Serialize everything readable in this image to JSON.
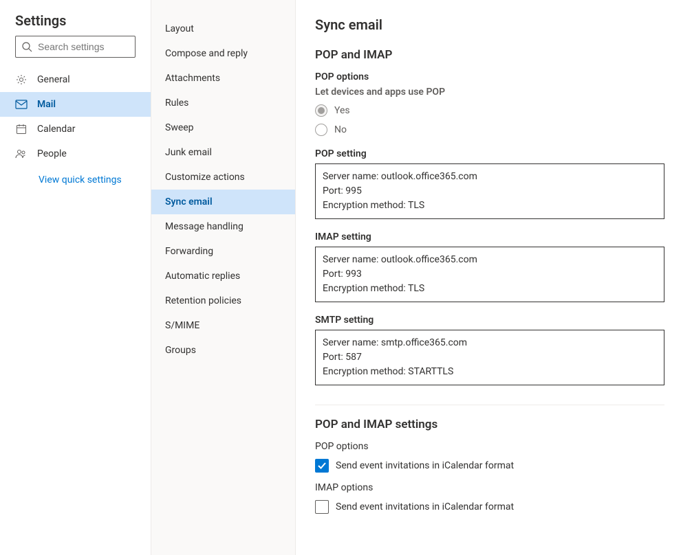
{
  "leftPanel": {
    "title": "Settings",
    "searchPlaceholder": "Search settings",
    "categories": [
      {
        "id": "general",
        "label": "General",
        "icon": "gear"
      },
      {
        "id": "mail",
        "label": "Mail",
        "icon": "mail",
        "selected": true
      },
      {
        "id": "calendar",
        "label": "Calendar",
        "icon": "calendar"
      },
      {
        "id": "people",
        "label": "People",
        "icon": "people"
      }
    ],
    "quickLink": "View quick settings"
  },
  "midPanel": {
    "items": [
      "Layout",
      "Compose and reply",
      "Attachments",
      "Rules",
      "Sweep",
      "Junk email",
      "Customize actions",
      "Sync email",
      "Message handling",
      "Forwarding",
      "Automatic replies",
      "Retention policies",
      "S/MIME",
      "Groups"
    ],
    "selectedIndex": 7
  },
  "main": {
    "title": "Sync email",
    "sectionA": {
      "heading": "POP and IMAP",
      "popOptions": {
        "label": "POP options",
        "sublabel": "Let devices and apps use POP",
        "yes": "Yes",
        "no": "No"
      },
      "popSetting": {
        "title": "POP setting",
        "server": "Server name: outlook.office365.com",
        "port": "Port: 995",
        "enc": "Encryption method: TLS"
      },
      "imapSetting": {
        "title": "IMAP setting",
        "server": "Server name: outlook.office365.com",
        "port": "Port: 993",
        "enc": "Encryption method: TLS"
      },
      "smtpSetting": {
        "title": "SMTP setting",
        "server": "Server name: smtp.office365.com",
        "port": "Port: 587",
        "enc": "Encryption method: STARTTLS"
      }
    },
    "sectionB": {
      "heading": "POP and IMAP settings",
      "popLabel": "POP options",
      "popCheckbox": "Send event invitations in iCalendar format",
      "imapLabel": "IMAP options",
      "imapCheckbox": "Send event invitations in iCalendar format"
    }
  }
}
